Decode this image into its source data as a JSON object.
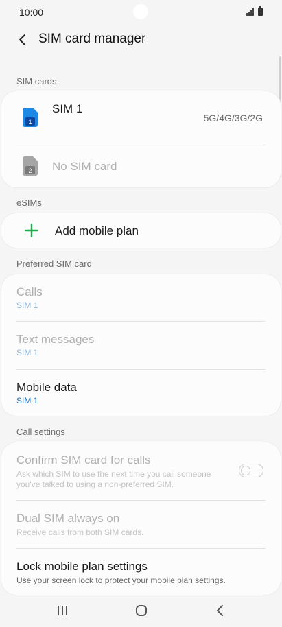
{
  "status": {
    "time": "10:00"
  },
  "header": {
    "title": "SIM card manager"
  },
  "sections": {
    "sim_cards": "SIM cards",
    "esims": "eSIMs",
    "preferred": "Preferred SIM card",
    "call_settings": "Call settings"
  },
  "sim_cards": [
    {
      "name": "SIM 1",
      "network": "5G/4G/3G/2G",
      "slot": "1",
      "color": "#1e88e5"
    },
    {
      "name": "No SIM card",
      "slot": "2",
      "color": "#9e9e9e"
    }
  ],
  "esim": {
    "add_label": "Add mobile plan",
    "accent": "#1fa84f"
  },
  "preferred": {
    "calls": {
      "title": "Calls",
      "value": "SIM 1"
    },
    "text_messages": {
      "title": "Text messages",
      "value": "SIM 1"
    },
    "mobile_data": {
      "title": "Mobile data",
      "value": "SIM 1"
    }
  },
  "call_settings": {
    "confirm": {
      "title": "Confirm SIM card for calls",
      "desc_line1": "Ask which SIM to use the next time you call someone",
      "desc_line2": "you've talked to using a non-preferred SIM.",
      "enabled": false
    },
    "dual": {
      "title": "Dual SIM always on",
      "desc": "Receive calls from both SIM cards."
    },
    "lock": {
      "title": "Lock mobile plan settings",
      "desc": "Use your screen lock to protect your mobile plan settings."
    }
  }
}
